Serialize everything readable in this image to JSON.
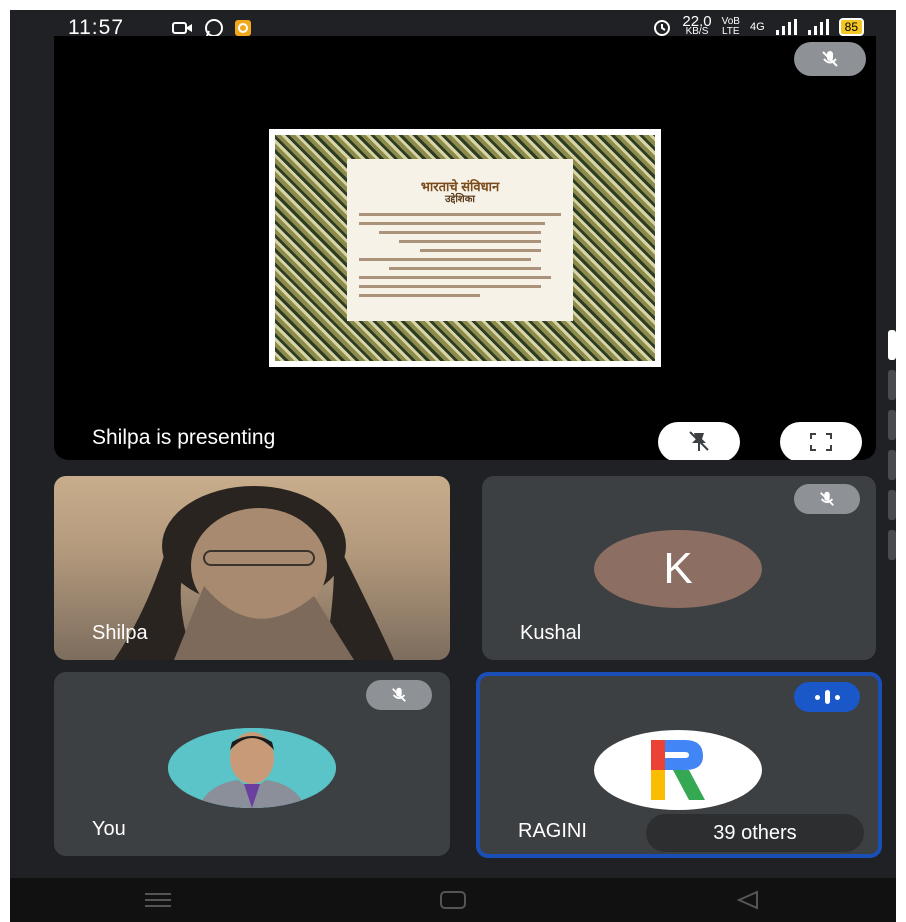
{
  "status": {
    "time": "11:57",
    "speed_value": "22.0",
    "speed_unit": "KB/S",
    "volte": "VoB",
    "volte2": "LTE",
    "network": "4G",
    "battery": "85"
  },
  "presentation": {
    "label": "Shilpa is presenting",
    "slide_title": "भारताचे संविधान",
    "slide_heading": "उद्देशिका"
  },
  "participants": [
    {
      "name": "Shilpa"
    },
    {
      "name": "Kushal",
      "initial": "K"
    },
    {
      "name": "You"
    },
    {
      "name": "RAGINI",
      "others": "39 others"
    }
  ],
  "colors": {
    "background": "#202124",
    "tile": "#3c4043",
    "active_border": "#1a4fb8",
    "avatar_k": "#8d6e63"
  }
}
